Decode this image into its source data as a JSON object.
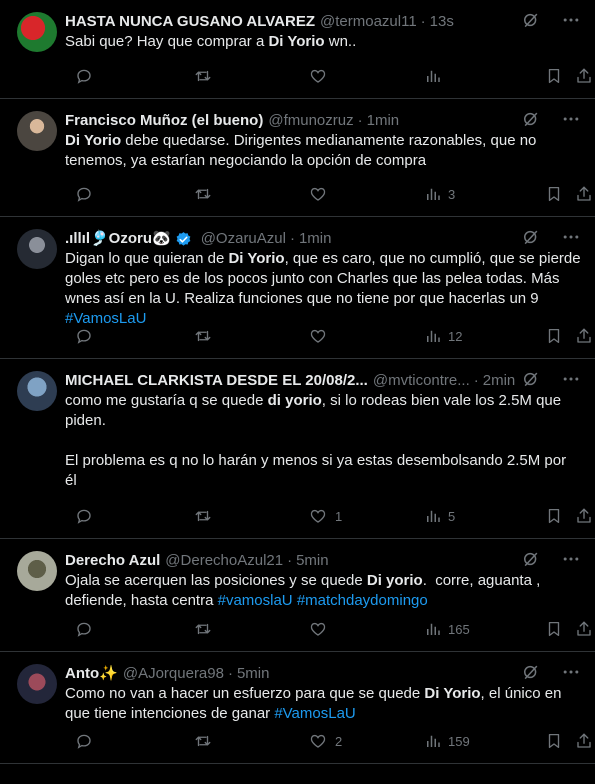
{
  "tweets": [
    {
      "name": "HASTA NUNCA GUSANO ALVAREZ",
      "handle": "@termoazul11",
      "time": "13s",
      "segments": [
        {
          "t": "Sabi que? Hay que comprar a ",
          "s": "n"
        },
        {
          "t": "Di Yorio",
          "s": "b"
        },
        {
          "t": " wn..",
          "s": "n"
        }
      ],
      "replies": "",
      "retweets": "",
      "likes": "",
      "views": ""
    },
    {
      "name": "Francisco Muñoz (el bueno)",
      "handle": "@fmunozruz",
      "time": "1min",
      "segments": [
        {
          "t": "Di Yorio",
          "s": "b"
        },
        {
          "t": " debe quedarse. Dirigentes medianamente razonables, que no tenemos, ya estarían negociando la opción de compra",
          "s": "n"
        }
      ],
      "replies": "",
      "retweets": "",
      "likes": "",
      "views": "3"
    },
    {
      "name": ".ıllıl🎐Ozoru🐼",
      "verified": true,
      "handle": "@OzaruAzul",
      "time": "1min",
      "segments": [
        {
          "t": "Digan lo que quieran de ",
          "s": "n"
        },
        {
          "t": "Di Yorio",
          "s": "b"
        },
        {
          "t": ", que es caro, que no cumplió, que se pierde goles etc pero es de los pocos junto con Charles que las pelea todas. Más wnes así en la U. Realiza funciones que no tiene por que hacerlas un 9\n",
          "s": "n"
        },
        {
          "t": "#VamosLaU",
          "s": "tag"
        }
      ],
      "replies": "",
      "retweets": "",
      "likes": "",
      "views": "12"
    },
    {
      "name": "MICHAEL CLARKISTA DESDE EL 20/08/2...",
      "handle": "@mvticontre...",
      "time": "2min",
      "segments": [
        {
          "t": "como me gustaría q se quede ",
          "s": "n"
        },
        {
          "t": "di yorio",
          "s": "b"
        },
        {
          "t": ", si lo rodeas bien vale los 2.5M que piden.\n\nEl problema es q no lo harán y menos si ya estas desembolsando 2.5M por él",
          "s": "n"
        }
      ],
      "replies": "",
      "retweets": "",
      "likes": "1",
      "views": "5"
    },
    {
      "name": "Derecho Azul",
      "handle": "@DerechoAzul21",
      "time": "5min",
      "segments": [
        {
          "t": "Ojala se acerquen las posiciones y se quede ",
          "s": "n"
        },
        {
          "t": "Di yorio",
          "s": "b"
        },
        {
          "t": ".  corre, aguanta , defiende, hasta centra ",
          "s": "n"
        },
        {
          "t": "#vamoslaU",
          "s": "tag"
        },
        {
          "t": " ",
          "s": "n"
        },
        {
          "t": "#matchdaydomingo",
          "s": "tag"
        }
      ],
      "replies": "",
      "retweets": "",
      "likes": "",
      "views": "165"
    },
    {
      "name": "Anto✨",
      "handle": "@AJorquera98",
      "time": "5min",
      "segments": [
        {
          "t": "Como no van a hacer un esfuerzo para que se quede ",
          "s": "n"
        },
        {
          "t": "Di Yorio",
          "s": "b"
        },
        {
          "t": ", el único en que tiene intenciones de ganar ",
          "s": "n"
        },
        {
          "t": "#VamosLaU",
          "s": "tag"
        }
      ],
      "replies": "",
      "retweets": "",
      "likes": "2",
      "views": "159"
    }
  ],
  "colors": {
    "background": "#000000",
    "text": "#e7e9ea",
    "muted": "#71767b",
    "link": "#1d9bf0",
    "divider": "#2f3336",
    "verified": "#1d9bf0"
  }
}
